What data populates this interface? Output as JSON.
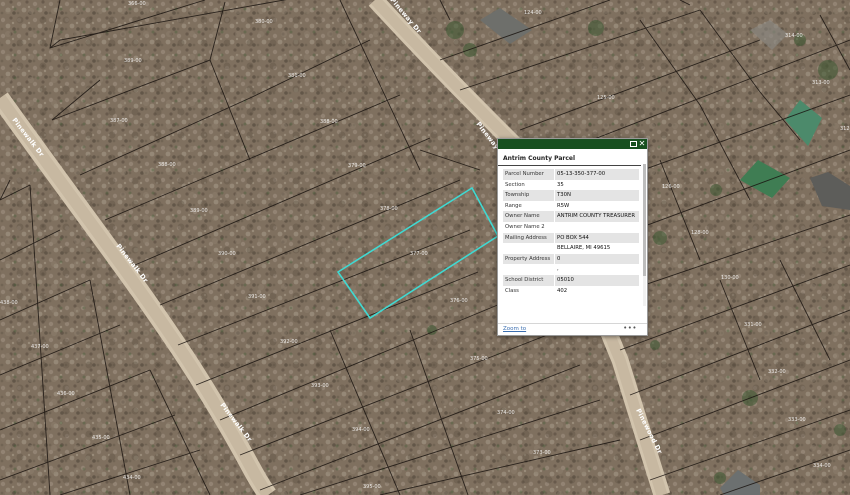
{
  "map": {
    "roads": [
      "Pinewalk Dr",
      "Pinewalk Dr",
      "Pinewalk Dr",
      "Pineway Dr",
      "Pineway Dr",
      "Pinewood Dr"
    ],
    "parcel_labels": [
      "366-00",
      "380-00",
      "389-00",
      "381-00",
      "387-00",
      "388-00",
      "388-00",
      "379-00",
      "389-00",
      "378-00",
      "390-00",
      "377-00",
      "438-00",
      "391-00",
      "376-00",
      "437-00",
      "392-00",
      "375-00",
      "436-00",
      "393-00",
      "374-00",
      "435-00",
      "394-00",
      "373-00",
      "434-00",
      "395-00",
      "124-00",
      "125-00",
      "126-00",
      "128-00",
      "130-00",
      "331-00",
      "332-00",
      "333-00",
      "334-00",
      "314-00",
      "313-00",
      "312-00"
    ],
    "selected_parcel": "377-00",
    "colors": {
      "selection": "#3fd9d2",
      "parcel_lines": "#1a1410"
    }
  },
  "popup": {
    "header_color": "#17501f",
    "title": "Antrim County Parcel",
    "maximize_icon": "maximize-icon",
    "close_icon": "close-icon",
    "rows": [
      {
        "key": "Parcel Number",
        "value": "05-13-350-377-00"
      },
      {
        "key": "Section",
        "value": "35"
      },
      {
        "key": "Township",
        "value": "T30N"
      },
      {
        "key": "Range",
        "value": "R5W"
      },
      {
        "key": "Owner Name",
        "value": "ANTRIM COUNTY TREASURER"
      },
      {
        "key": "Owner Name 2",
        "value": ""
      },
      {
        "key": "Mailing Address",
        "value": "PO BOX 544"
      },
      {
        "key": "",
        "value": "BELLAIRE, MI 49615"
      },
      {
        "key": "Property Address",
        "value": "0"
      },
      {
        "key": "",
        "value": ","
      },
      {
        "key": "School District",
        "value": "05010"
      },
      {
        "key": "Class",
        "value": "402"
      }
    ],
    "footer": {
      "zoom_label": "Zoom to",
      "more_label": "•••"
    }
  }
}
